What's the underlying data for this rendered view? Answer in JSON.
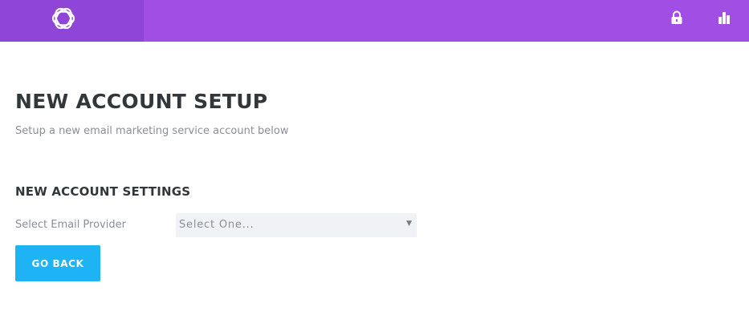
{
  "header": {
    "logo_icon": "bloom-logo-icon",
    "right_icons": [
      "lock-icon",
      "bar-chart-icon"
    ],
    "colors": {
      "bar": "#a04ee4",
      "logo_block": "#8f45d8"
    }
  },
  "main": {
    "title": "NEW ACCOUNT SETUP",
    "subtitle": "Setup a new email marketing service account below",
    "section_title": "NEW ACCOUNT SETTINGS",
    "provider_field": {
      "label": "Select Email Provider",
      "selected": "Select One..."
    },
    "go_back_label": "GO BACK",
    "colors": {
      "button": "#1eb3f5"
    }
  }
}
